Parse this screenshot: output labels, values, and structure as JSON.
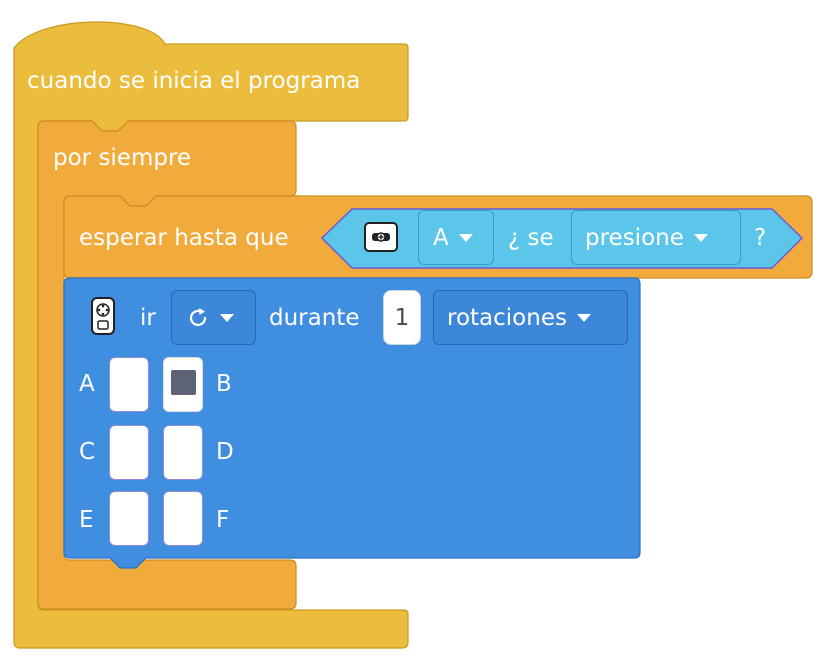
{
  "hat_block": {
    "label": "cuando se inicia el programa"
  },
  "forever_block": {
    "label": "por siempre"
  },
  "wait_block": {
    "label": "esperar hasta que",
    "condition": {
      "sensor_icon": "force-sensor-icon",
      "port_value": "A",
      "middle_text": "¿ se",
      "state_value": "presione",
      "end_text": "?"
    }
  },
  "motor_block": {
    "motor_icon": "motor-icon",
    "ir_label": "ir",
    "direction_icon": "clockwise-rotate-icon",
    "durante_label": "durante",
    "amount_value": "1",
    "unit_value": "rotaciones",
    "ports": [
      {
        "left": "A",
        "right": "B",
        "left_selected": false,
        "right_selected": true
      },
      {
        "left": "C",
        "right": "D",
        "left_selected": false,
        "right_selected": false
      },
      {
        "left": "E",
        "right": "F",
        "left_selected": false,
        "right_selected": false
      }
    ]
  },
  "colors": {
    "events_yellow": "#ecbd3c",
    "control_orange": "#f0ab3c",
    "motor_blue": "#408ee0",
    "sensor_cyan": "#5cc6ea"
  }
}
